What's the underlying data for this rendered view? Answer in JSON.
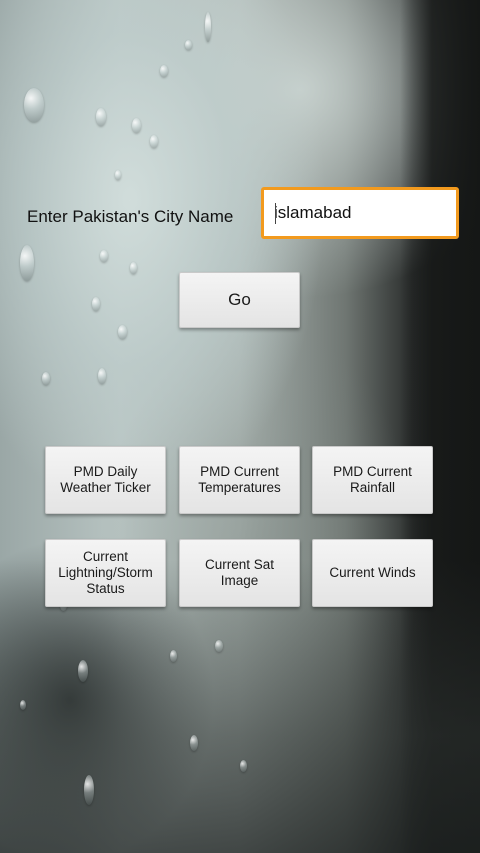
{
  "form": {
    "city_label": "Enter Pakistan's City Name",
    "city_value": "islamabad",
    "go_label": "Go"
  },
  "actions": [
    {
      "label": "PMD Daily\nWeather Ticker"
    },
    {
      "label": "PMD Current\nTemperatures"
    },
    {
      "label": "PMD Current\nRainfall"
    },
    {
      "label": "Current\nLightning/Storm\nStatus"
    },
    {
      "label": "Current Sat\nImage"
    },
    {
      "label": "Current Winds"
    }
  ],
  "colors": {
    "input_focus_border": "#f29a1e",
    "button_face": "#ececec"
  }
}
